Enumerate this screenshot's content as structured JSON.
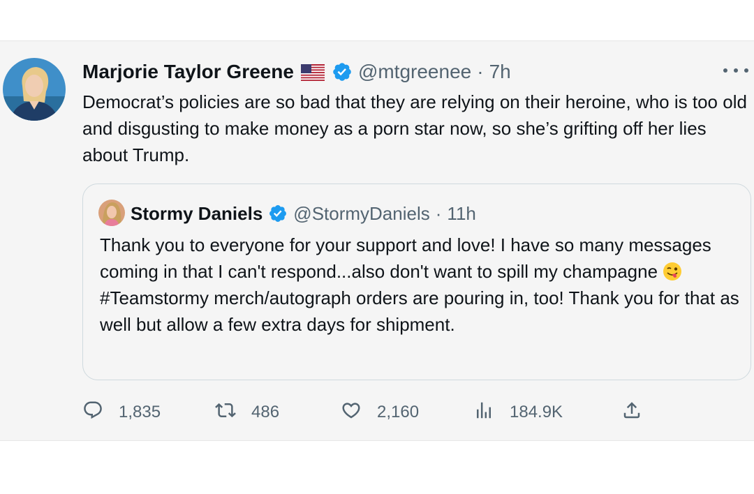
{
  "tweet": {
    "author": {
      "name": "Marjorie Taylor Greene",
      "handle": "@mtgreenee",
      "time": "7h",
      "flag_icon": "us-flag-icon",
      "verified_icon": "verified-badge-icon"
    },
    "separator": "·",
    "text": "Democrat’s policies are so bad that they are relying on their heroine, who is too old and disgusting to make money as a porn star now, so she’s grifting off her lies about Trump.",
    "quoted": {
      "name": "Stormy Daniels",
      "handle": "@StormyDaniels",
      "time": "11h",
      "text_line_1": "Thank you to everyone for your support and love! I have so many messages coming in that I can't respond...also don't want to spill my champagne",
      "emoji": "winking-face-with-tongue-emoji",
      "text_line_2": "#Teamstormy merch/autograph orders are pouring in, too! Thank you for that as well but allow a few extra days for shipment."
    },
    "actions": {
      "replies": "1,835",
      "retweets": "486",
      "likes": "2,160",
      "views": "184.9K"
    }
  },
  "colors": {
    "verified": "#1d9bf0",
    "secondary_text": "#536471",
    "card_background": "#f5f5f5",
    "quote_border": "#cfd9de"
  }
}
